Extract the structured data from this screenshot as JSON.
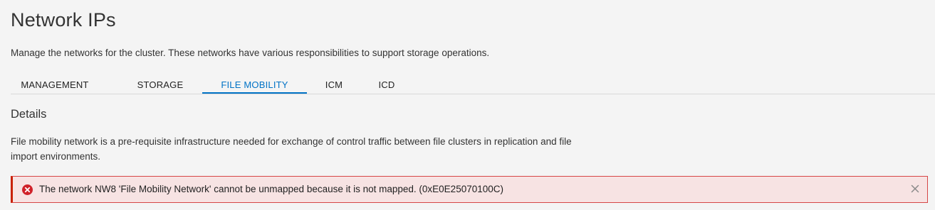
{
  "page": {
    "title": "Network IPs",
    "description": "Manage the networks for the cluster. These networks have various responsibilities to support storage operations."
  },
  "tabs": [
    {
      "label": "MANAGEMENT",
      "active": false
    },
    {
      "label": "STORAGE",
      "active": false
    },
    {
      "label": "FILE MOBILITY",
      "active": true
    },
    {
      "label": "ICM",
      "active": false
    },
    {
      "label": "ICD",
      "active": false
    }
  ],
  "details": {
    "heading": "Details",
    "text": "File mobility network is a pre-requisite infrastructure needed for exchange of control traffic between file clusters in replication and file import environments."
  },
  "alert": {
    "type": "error",
    "icon": "error-circle-icon",
    "message": "The network NW8 'File Mobility Network' cannot be unmapped because it is not mapped. (0xE0E25070100C)",
    "close_icon": "close-icon"
  },
  "colors": {
    "accent": "#0072c6",
    "error": "#d0222a",
    "alert_bg": "#f7e3e3",
    "page_bg": "#f4f4f4"
  }
}
